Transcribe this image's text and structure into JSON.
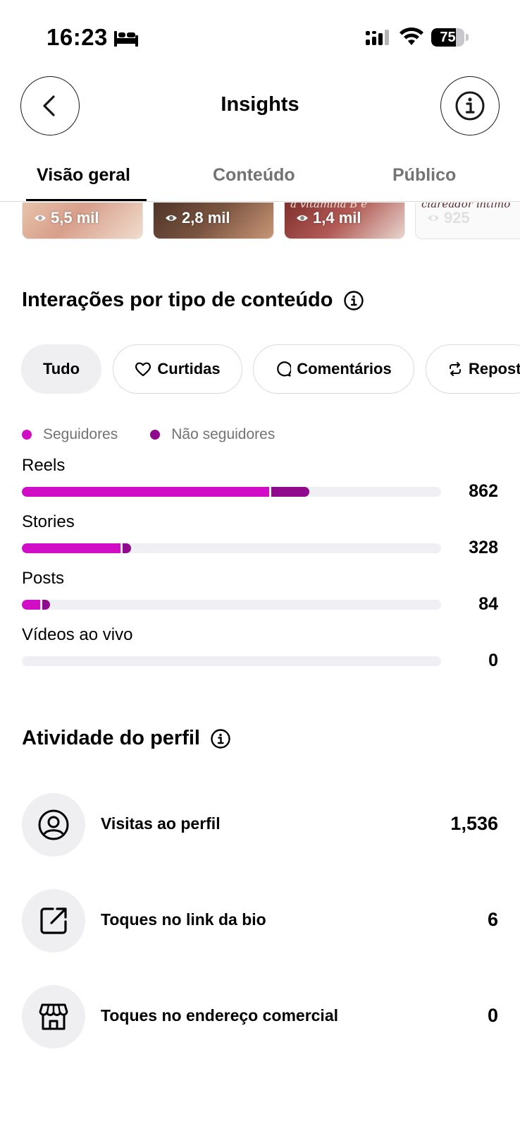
{
  "status_bar": {
    "time": "16:23",
    "battery": "75",
    "battery_level": 0.75
  },
  "header": {
    "title": "Insights"
  },
  "tabs": [
    {
      "label": "Visão geral",
      "active": true
    },
    {
      "label": "Conteúdo",
      "active": false
    },
    {
      "label": "Público",
      "active": false
    }
  ],
  "thumbnails": [
    {
      "views": "5,5 mil"
    },
    {
      "views": "2,8 mil"
    },
    {
      "views": "1,4 mil",
      "caption": "a vitamina B e"
    },
    {
      "views": "925",
      "caption": "clareador íntimo"
    }
  ],
  "interactions": {
    "title": "Interações por tipo de conteúdo",
    "filters": [
      {
        "label": "Tudo",
        "icon": "none",
        "selected": true
      },
      {
        "label": "Curtidas",
        "icon": "heart-icon",
        "selected": false
      },
      {
        "label": "Comentários",
        "icon": "comment-icon",
        "selected": false
      },
      {
        "label": "Reposts",
        "icon": "repost-icon",
        "selected": false
      }
    ],
    "legend": [
      {
        "label": "Seguidores",
        "color": "#d10ec6"
      },
      {
        "label": "Não seguidores",
        "color": "#8f0a8c"
      }
    ],
    "bars": [
      {
        "label": "Reels",
        "value": "862",
        "followers_fraction": 0.59,
        "non_followers_fraction": 0.09
      },
      {
        "label": "Stories",
        "value": "328",
        "followers_fraction": 0.235,
        "non_followers_fraction": 0.02
      },
      {
        "label": "Posts",
        "value": "84",
        "followers_fraction": 0.043,
        "non_followers_fraction": 0.02
      },
      {
        "label": "Vídeos ao vivo",
        "value": "0",
        "followers_fraction": 0,
        "non_followers_fraction": 0
      }
    ]
  },
  "profile_activity": {
    "title": "Atividade do perfil",
    "items": [
      {
        "label": "Visitas ao perfil",
        "value": "1,536",
        "icon": "profile-icon"
      },
      {
        "label": "Toques no link da bio",
        "value": "6",
        "icon": "external-link-icon"
      },
      {
        "label": "Toques no endereço comercial",
        "value": "0",
        "icon": "storefront-icon"
      }
    ]
  }
}
